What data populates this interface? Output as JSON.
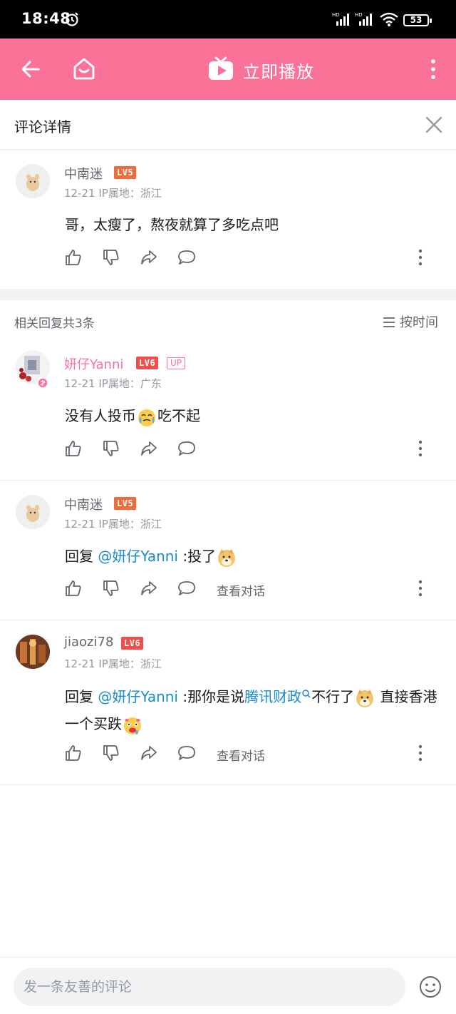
{
  "status_bar": {
    "time": "18:48",
    "battery": "53",
    "network_1": "HD",
    "network_2": "HD"
  },
  "app_bar": {
    "play_label": "立即播放",
    "accent_color": "#fb7299"
  },
  "detail_header": {
    "title": "评论详情"
  },
  "root_comment": {
    "username": "中南迷",
    "level": "LV5",
    "meta": "12-21 IP属地：浙江",
    "content": "哥，太瘦了，熬夜就算了多吃点吧"
  },
  "replies_header": {
    "count_label": "相关回复共3条",
    "sort_label": "按时间"
  },
  "replies": [
    {
      "username": "妍仔Yanni",
      "level": "LV6",
      "up_badge": "UP",
      "meta": "12-21 IP属地：广东",
      "text_before": "没有人投币",
      "emoji_1": "crying-laugh-emoji",
      "text_after": "吃不起"
    },
    {
      "username": "中南迷",
      "level": "LV5",
      "meta": "12-21 IP属地：浙江",
      "reply_prefix": "回复 ",
      "mention": "@妍仔Yanni",
      "text": " :投了",
      "emoji_1": "doge-emoji",
      "dialog_label": "查看对话"
    },
    {
      "username": "jiaozi78",
      "level": "LV6",
      "meta": "12-21 IP属地：浙江",
      "reply_prefix": "回复 ",
      "mention": "@妍仔Yanni",
      "text_1": " :那你是说",
      "search_link": "腾讯财政",
      "text_2": "不行了",
      "text_3": " 直接香港一个买跌",
      "emoji_1": "doge-emoji",
      "emoji_2": "drooling-emoji",
      "dialog_label": "查看对话"
    }
  ],
  "bottom_bar": {
    "placeholder": "发一条友善的评论"
  },
  "icons": [
    "back-arrow-icon",
    "home-icon",
    "tv-icon",
    "more-vertical-icon",
    "close-icon",
    "like-icon",
    "dislike-icon",
    "share-icon",
    "comment-icon",
    "sort-icon",
    "emoji-icon",
    "search-icon"
  ]
}
